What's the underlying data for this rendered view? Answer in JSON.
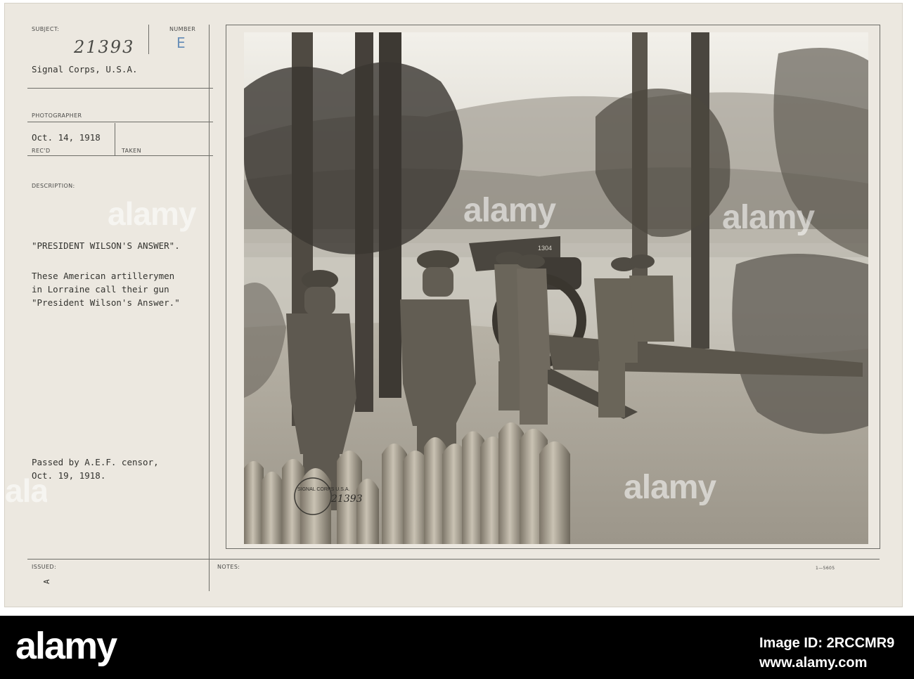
{
  "card": {
    "subject_label": "SUBJECT:",
    "subject_value": "21393",
    "number_label": "NUMBER",
    "number_value": "E",
    "corps": "Signal Corps, U.S.A.",
    "photographer_label": "PHOTOGRAPHER",
    "date_received": "Oct. 14, 1918",
    "recd_label": "REC'D",
    "taken_label": "TAKEN",
    "description_label": "DESCRIPTION:",
    "title": "\"PRESIDENT WILSON'S ANSWER\".",
    "description_lines": [
      "These American artillerymen",
      "in Lorraine call their gun",
      "\"President Wilson's Answer.\""
    ],
    "censor_lines": [
      "Passed by A.E.F. censor,",
      "Oct. 19, 1918."
    ],
    "issued_label": "ISSUED:",
    "issued_mark": "A",
    "notes_label": "NOTES:",
    "form_number": "1—5605"
  },
  "photo": {
    "stamp_text": "SIGNAL CORPS U.S.A.",
    "stamp_number": "21393",
    "gun_plate": "1304",
    "caption": "American artillerymen in Lorraine beside their gun \"President Wilson's Answer\""
  },
  "watermark": {
    "text": "alamy"
  },
  "footer": {
    "logo": "alamy",
    "image_id": "Image ID: 2RCCMR9",
    "url": "www.alamy.com"
  },
  "colors": {
    "card_paper": "#ece8e0",
    "photo_sepia": "#b9b5ab",
    "footer_bg": "#000000"
  }
}
